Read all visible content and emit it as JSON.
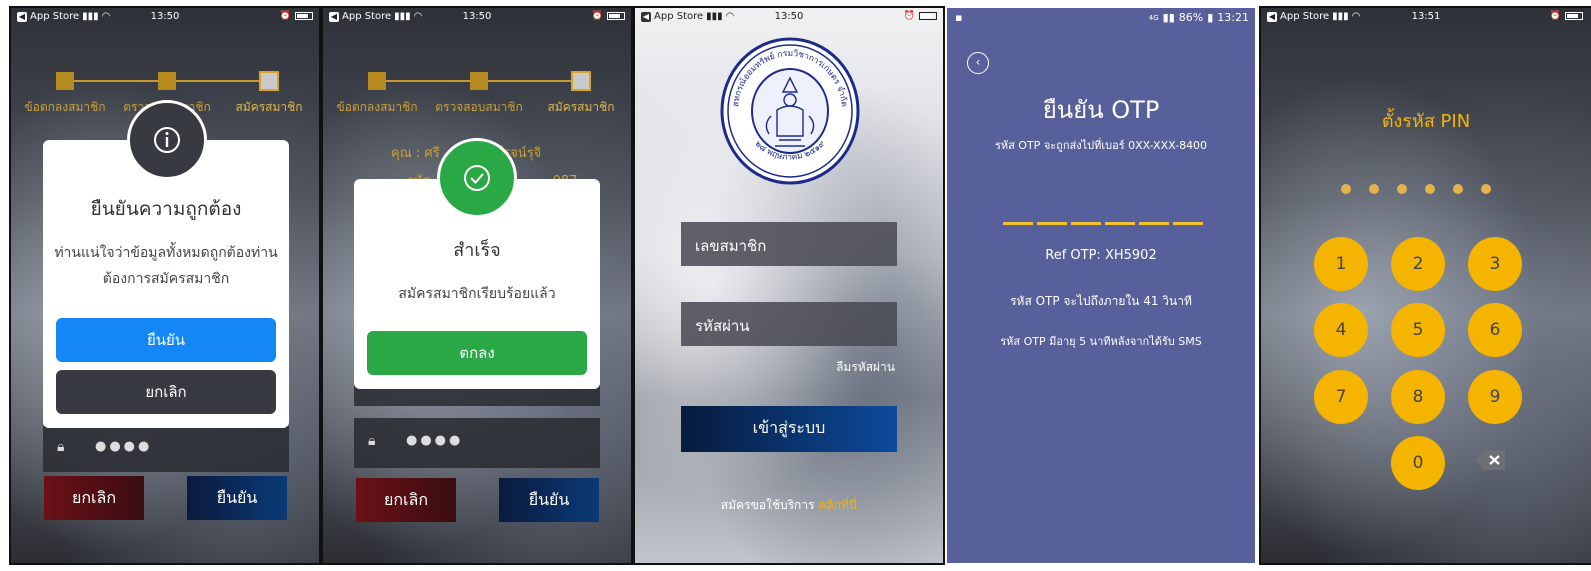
{
  "status_ios": {
    "carrier": "App Store",
    "time1": "13:50",
    "time2": "13:50",
    "time3": "13:50",
    "time5": "13:51"
  },
  "status_android": {
    "network": "4G",
    "battery": "86%",
    "time": "13:21"
  },
  "stepper": {
    "step1": "ข้อตกลงสมาชิก",
    "step2": "ตรวจสอบสมาชิก",
    "step3": "สมัครสมาชิก"
  },
  "screen1": {
    "modal_title": "ยืนยันความถูกต้อง",
    "modal_body_line1": "ท่านแน่ใจว่าข้อมูลทั้งหมดถูกต้องท่าน",
    "modal_body_line2": "ต้องการสมัครสมาชิก",
    "confirm_label": "ยืนยัน",
    "cancel_label": "ยกเลิก",
    "pin_mask": "●●●●",
    "bottom_cancel": "ยกเลิก",
    "bottom_confirm": "ยืนยัน"
  },
  "screen2": {
    "user_prefix": "คุณ : ศรี",
    "user_suffix": "ดีโรจน์รุจิ",
    "id_prefix": "รหัส",
    "id_suffix": "087",
    "modal_title": "สำเร็จ",
    "modal_body": "สมัครสมาชิกเรียบร้อยแล้ว",
    "ok_label": "ตกลง",
    "pin_mask": "●●●●",
    "bottom_cancel": "ยกเลิก",
    "bottom_confirm": "ยืนยัน"
  },
  "screen3": {
    "logo_text_top": "สหกรณ์ออมทรัพย์ กรมวิชาการเกษตร จำกัด",
    "logo_text_bottom": "๒๘ พฤษภาคม ๒๕๑๙",
    "member_placeholder": "เลขสมาชิก",
    "password_placeholder": "รหัสผ่าน",
    "forgot_password": "ลืมรหัสผ่าน",
    "login_label": "เข้าสู่ระบบ",
    "signup_text": "สมัครขอใช้บริการ",
    "signup_link": "คลิกที่นี่"
  },
  "screen4": {
    "title": "ยืนยัน OTP",
    "subtitle": "รหัส OTP จะถูกส่งไปที่เบอร์  0XX-XXX-8400",
    "ref": "Ref OTP: XH5902",
    "countdown": "รหัส OTP จะไปถึงภายใน 41 วินาที",
    "expiry": "รหัส OTP มีอายุ 5 นาทีหลังจากได้รับ SMS",
    "otp_length": 6
  },
  "screen5": {
    "title": "ตั้งรหัส PIN",
    "pin_length": 6,
    "keys": [
      "1",
      "2",
      "3",
      "4",
      "5",
      "6",
      "7",
      "8",
      "9",
      "0"
    ]
  },
  "colors": {
    "blue_button": "#1487f7",
    "dark_button": "#373a40",
    "green": "#29a845",
    "otp_bg": "#58609c",
    "gold": "#f5b400",
    "red_button": "#6b1116",
    "navy_button": "#0a3a78"
  }
}
